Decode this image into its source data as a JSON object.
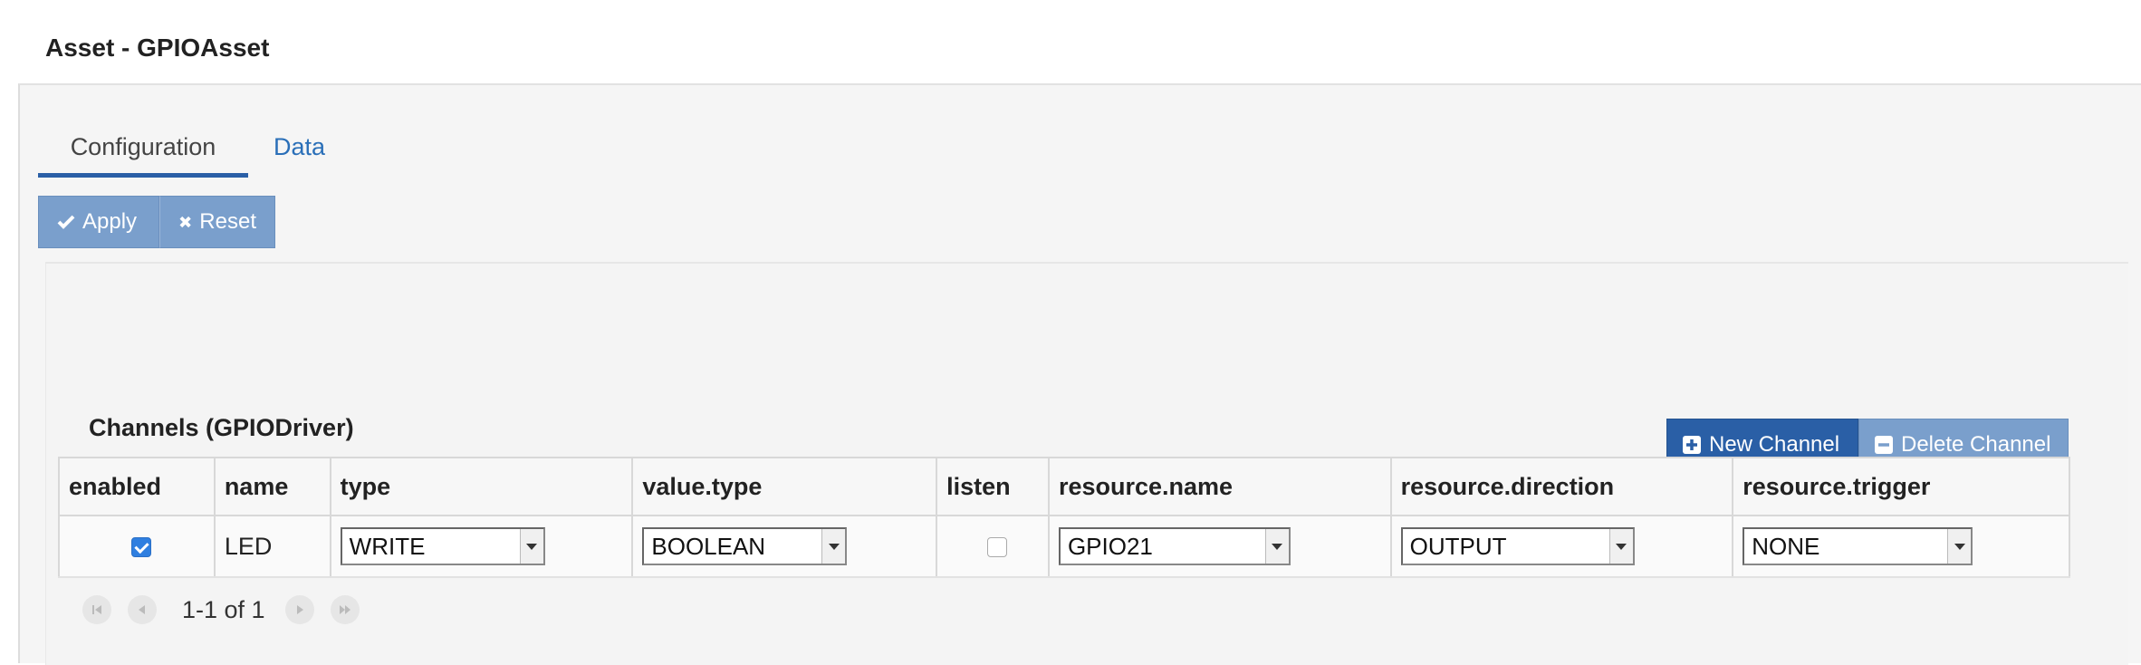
{
  "window": {
    "title": "Asset - GPIOAsset"
  },
  "tabs": [
    {
      "label": "Configuration",
      "active": true
    },
    {
      "label": "Data",
      "active": false
    }
  ],
  "toolbar": {
    "apply_label": "Apply",
    "reset_label": "Reset"
  },
  "channels": {
    "title": "Channels (GPIODriver)",
    "new_label": "New Channel",
    "delete_label": "Delete Channel",
    "columns": [
      "enabled",
      "name",
      "type",
      "value.type",
      "listen",
      "resource.name",
      "resource.direction",
      "resource.trigger"
    ],
    "rows": [
      {
        "enabled": true,
        "name": "LED",
        "type": "WRITE",
        "value_type": "BOOLEAN",
        "listen": false,
        "resource_name": "GPIO21",
        "resource_direction": "OUTPUT",
        "resource_trigger": "NONE"
      }
    ]
  },
  "pager": {
    "text": "1-1 of 1"
  },
  "colors": {
    "accent": "#2a5fa6",
    "button_light": "#7a9fcc",
    "link": "#2a6fb8",
    "checkbox": "#2f7fe0"
  },
  "icons": {
    "apply": "checkmark-icon",
    "reset": "x-icon",
    "new": "plus-square-icon",
    "delete": "minus-square-icon",
    "first": "first-page-icon",
    "prev": "previous-page-icon",
    "next": "next-page-icon",
    "last": "last-page-icon"
  }
}
